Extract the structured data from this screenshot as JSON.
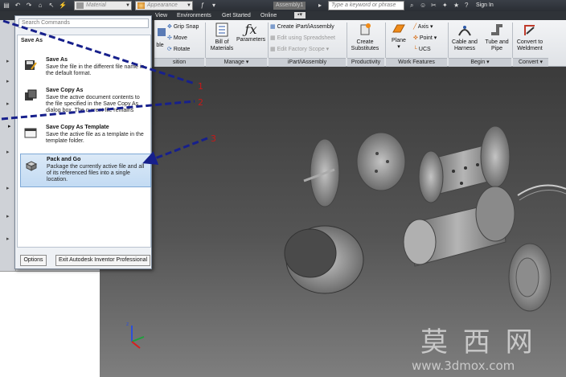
{
  "quick_access": {
    "material_placeholder": "Material",
    "appearance_placeholder": "Appearance",
    "document_title": "Assembly1",
    "search_placeholder": "Type a keyword or phrase",
    "sign_in": "Sign In"
  },
  "tabs": [
    "View",
    "Environments",
    "Get Started",
    "Online"
  ],
  "ribbon": {
    "position": {
      "items": [
        "Grip Snap",
        "Move",
        "Rotate"
      ],
      "partial_label": "ble",
      "label": "sition"
    },
    "manage": {
      "bill_of_materials": "Bill of Materials",
      "parameters": "Parameters",
      "label": "Manage"
    },
    "ipart": {
      "items": [
        "Create iPart/iAssembly",
        "Edit using Spreadsheet",
        "Edit Factory Scope"
      ],
      "label": "iPart/iAssembly"
    },
    "productivity": {
      "create_substitutes": "Create Substitutes",
      "label": "Productivity"
    },
    "work_features": {
      "plane": "Plane",
      "axis": "Axis",
      "point": "Point",
      "ucs": "UCS",
      "label": "Work Features"
    },
    "begin": {
      "cable_harness": "Cable and Harness",
      "tube_pipe": "Tube and Pipe",
      "label": "Begin"
    },
    "convert": {
      "convert_weldment": "Convert to Weldment",
      "label": "Convert"
    }
  },
  "app_menu": {
    "search_placeholder": "Search Commands",
    "submenu_title": "Save As",
    "items": [
      {
        "title": "Save As",
        "desc": "Save the file in the different file name in the default format."
      },
      {
        "title": "Save Copy As",
        "desc": "Save the active document contents to the file specified in the Save Copy As dialog box. The current file remains"
      },
      {
        "title": "Save Copy As Template",
        "desc": "Save the active file as a template in the template folder."
      },
      {
        "title": "Pack and Go",
        "desc": "Package the currently active file and all of its referenced files into a single location."
      }
    ],
    "options_button": "Options",
    "exit_button": "Exit Autodesk Inventor Professional"
  },
  "annotations": [
    "1",
    "2",
    "3"
  ],
  "watermark": {
    "chinese": "莫 西 网",
    "url": "www.3dmox.com"
  },
  "colors": {
    "annotation_arrow": "#17208c",
    "annotation_number": "#c81818",
    "highlight": "#c3dbf3"
  }
}
